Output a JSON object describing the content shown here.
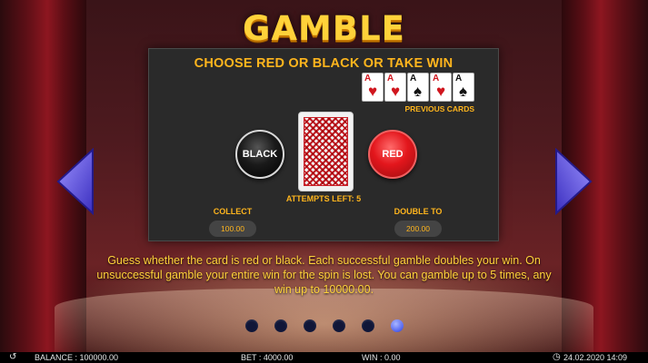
{
  "title": "GAMBLE",
  "panel": {
    "headline": "CHOOSE RED OR BLACK OR TAKE WIN",
    "previous_cards_label": "PREVIOUS CARDS",
    "previous_cards": [
      {
        "rank": "A",
        "suit": "♥",
        "color": "red"
      },
      {
        "rank": "A",
        "suit": "♥",
        "color": "red"
      },
      {
        "rank": "A",
        "suit": "♠",
        "color": "black"
      },
      {
        "rank": "A",
        "suit": "♥",
        "color": "red"
      },
      {
        "rank": "A",
        "suit": "♠",
        "color": "black"
      }
    ],
    "black_button": "BLACK",
    "red_button": "RED",
    "attempts_left": "ATTEMPTS LEFT: 5",
    "collect_label": "COLLECT",
    "collect_value": "100.00",
    "double_label": "DOUBLE TO",
    "double_value": "200.00"
  },
  "description": "Guess whether the card is red or black. Each successful gamble doubles your win. On unsuccessful gamble your entire win for the spin is lost. You can gamble up to 5 times, any win up to 10000.00.",
  "pagination": {
    "total": 6,
    "active_index": 5
  },
  "bottom_bar": {
    "balance": "BALANCE : 100000.00",
    "bet": "BET : 4000.00",
    "win": "WIN : 0.00",
    "datetime": "24.02.2020 14:09"
  },
  "colors": {
    "accent_gold": "#ffb51d",
    "title_gold": "#ffd23a",
    "arrow_purple": "#5a4fe0",
    "red_button": "#e3161c"
  },
  "icons": [
    "back-icon",
    "clock-icon",
    "arrow-left-icon",
    "arrow-right-icon"
  ]
}
